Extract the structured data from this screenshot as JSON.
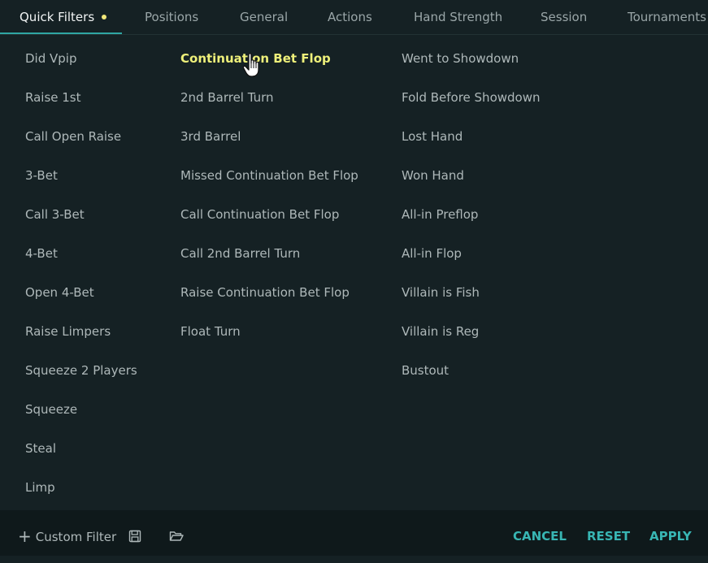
{
  "tabs": [
    {
      "label": "Quick Filters"
    },
    {
      "label": "Positions"
    },
    {
      "label": "General"
    },
    {
      "label": "Actions"
    },
    {
      "label": "Hand Strength"
    },
    {
      "label": "Session"
    },
    {
      "label": "Tournaments"
    }
  ],
  "columns": [
    {
      "items": [
        "Did Vpip",
        "Raise 1st",
        "Call Open Raise",
        "3-Bet",
        "Call 3-Bet",
        "4-Bet",
        "Open 4-Bet",
        "Raise Limpers",
        "Squeeze 2 Players",
        "Squeeze",
        "Steal",
        "Limp"
      ]
    },
    {
      "items": [
        "Continuation Bet Flop",
        "2nd Barrel Turn",
        "3rd Barrel",
        "Missed Continuation Bet Flop",
        "Call Continuation Bet Flop",
        "Call 2nd Barrel Turn",
        "Raise Continuation Bet Flop",
        "Float Turn"
      ]
    },
    {
      "items": [
        "Went to Showdown",
        "Fold Before Showdown",
        "Lost Hand",
        "Won Hand",
        "All-in Preflop",
        "All-in Flop",
        "Villain is Fish",
        "Villain is Reg",
        "Bustout"
      ]
    }
  ],
  "footer": {
    "plus_symbol": "+",
    "custom_filter": "Custom Filter",
    "cancel": "CANCEL",
    "reset": "RESET",
    "apply": "APPLY"
  },
  "colors": {
    "background": "#152124",
    "footer_background": "#0f191b",
    "accent": "#38b6b4",
    "highlight": "#eef07a",
    "indicator_dot": "#f1e77a"
  },
  "icons": {
    "active_tab_dot": "dot-icon",
    "save": "save-icon",
    "open": "folder-open-icon",
    "cursor": "hand-pointer-icon"
  }
}
